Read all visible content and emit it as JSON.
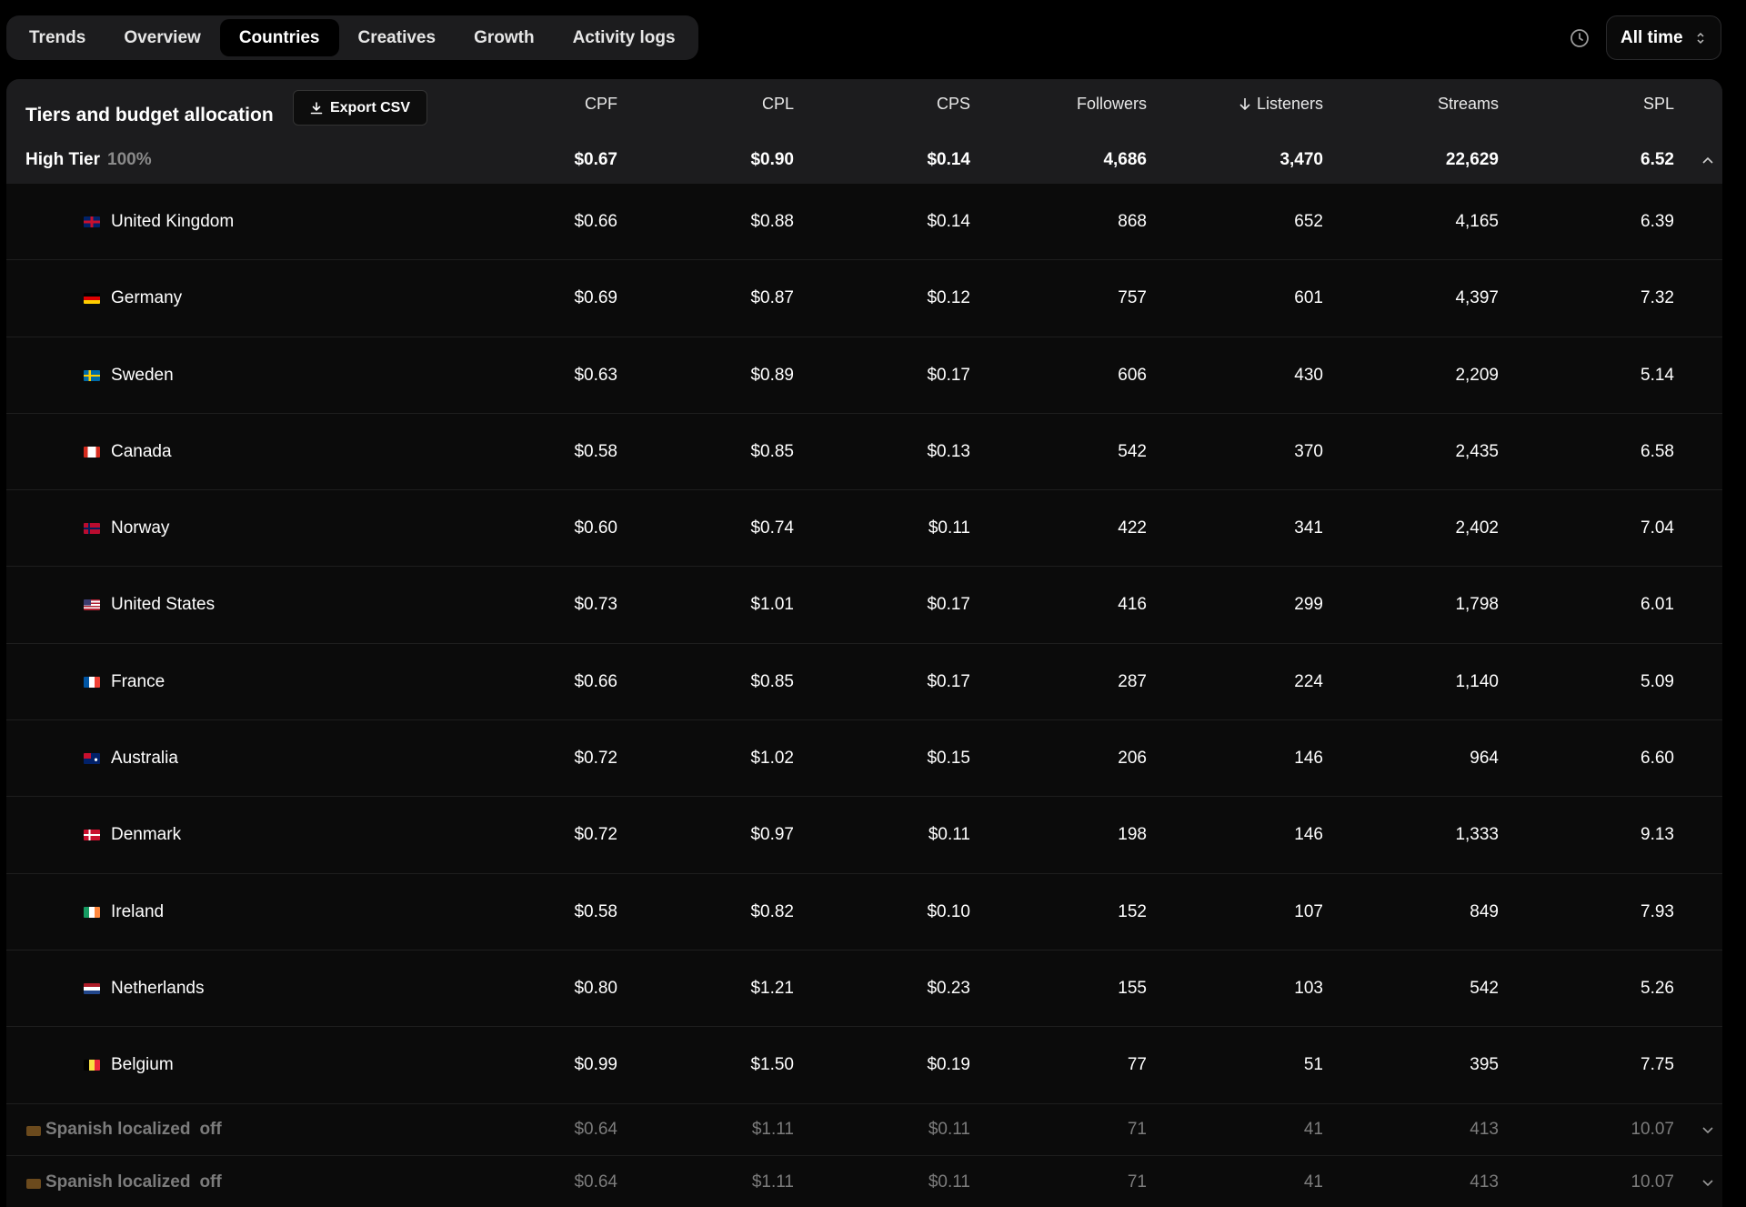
{
  "tabs": [
    "Trends",
    "Overview",
    "Countries",
    "Creatives",
    "Growth",
    "Activity logs"
  ],
  "active_tab": "Countries",
  "period": {
    "label": "All time"
  },
  "panel": {
    "title": "Tiers and budget allocation",
    "export_label": "Export CSV"
  },
  "columns": [
    "CPF",
    "CPL",
    "CPS",
    "Followers",
    "Listeners",
    "Streams",
    "SPL"
  ],
  "sorted_column": "Listeners",
  "tier": {
    "name": "High Tier",
    "percent": "100%",
    "values": [
      "$0.67",
      "$0.90",
      "$0.14",
      "4,686",
      "3,470",
      "22,629",
      "6.52"
    ]
  },
  "rows": [
    {
      "flag": "gb",
      "country": "United Kingdom",
      "values": [
        "$0.66",
        "$0.88",
        "$0.14",
        "868",
        "652",
        "4,165",
        "6.39"
      ]
    },
    {
      "flag": "de",
      "country": "Germany",
      "values": [
        "$0.69",
        "$0.87",
        "$0.12",
        "757",
        "601",
        "4,397",
        "7.32"
      ]
    },
    {
      "flag": "se",
      "country": "Sweden",
      "values": [
        "$0.63",
        "$0.89",
        "$0.17",
        "606",
        "430",
        "2,209",
        "5.14"
      ]
    },
    {
      "flag": "ca",
      "country": "Canada",
      "values": [
        "$0.58",
        "$0.85",
        "$0.13",
        "542",
        "370",
        "2,435",
        "6.58"
      ]
    },
    {
      "flag": "no",
      "country": "Norway",
      "values": [
        "$0.60",
        "$0.74",
        "$0.11",
        "422",
        "341",
        "2,402",
        "7.04"
      ]
    },
    {
      "flag": "us",
      "country": "United States",
      "values": [
        "$0.73",
        "$1.01",
        "$0.17",
        "416",
        "299",
        "1,798",
        "6.01"
      ]
    },
    {
      "flag": "fr",
      "country": "France",
      "values": [
        "$0.66",
        "$0.85",
        "$0.17",
        "287",
        "224",
        "1,140",
        "5.09"
      ]
    },
    {
      "flag": "au",
      "country": "Australia",
      "values": [
        "$0.72",
        "$1.02",
        "$0.15",
        "206",
        "146",
        "964",
        "6.60"
      ]
    },
    {
      "flag": "dk",
      "country": "Denmark",
      "values": [
        "$0.72",
        "$0.97",
        "$0.11",
        "198",
        "146",
        "1,333",
        "9.13"
      ]
    },
    {
      "flag": "ie",
      "country": "Ireland",
      "values": [
        "$0.58",
        "$0.82",
        "$0.10",
        "152",
        "107",
        "849",
        "7.93"
      ]
    },
    {
      "flag": "nl",
      "country": "Netherlands",
      "values": [
        "$0.80",
        "$1.21",
        "$0.23",
        "155",
        "103",
        "542",
        "5.26"
      ]
    },
    {
      "flag": "be",
      "country": "Belgium",
      "values": [
        "$0.99",
        "$1.50",
        "$0.19",
        "77",
        "51",
        "395",
        "7.75"
      ]
    }
  ],
  "sub_tiers": [
    {
      "name": "Spanish localized",
      "status": "off",
      "values": [
        "$0.64",
        "$1.11",
        "$0.11",
        "71",
        "41",
        "413",
        "10.07"
      ]
    },
    {
      "name": "Spanish localized",
      "status": "off",
      "values": [
        "$0.64",
        "$1.11",
        "$0.11",
        "71",
        "41",
        "413",
        "10.07"
      ]
    }
  ]
}
